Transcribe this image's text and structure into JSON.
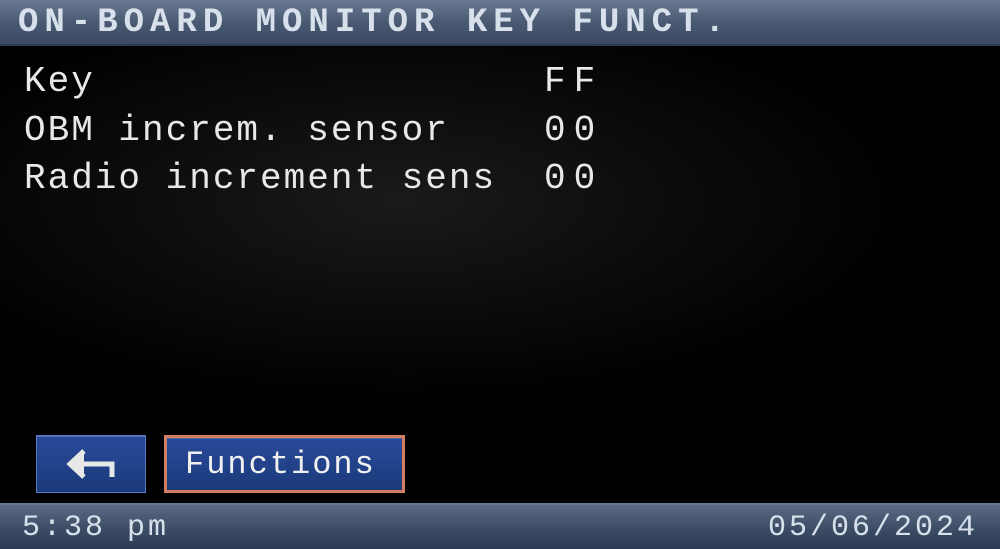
{
  "title": "ON-BOARD MONITOR KEY FUNCT.",
  "rows": [
    {
      "label": "Key",
      "value": "FF"
    },
    {
      "label": "OBM increm. sensor",
      "value": "00"
    },
    {
      "label": "Radio increment sens",
      "value": "00"
    }
  ],
  "buttons": {
    "functions_label": "Functions"
  },
  "status": {
    "time": "5:38 pm",
    "date": "05/06/2024"
  }
}
